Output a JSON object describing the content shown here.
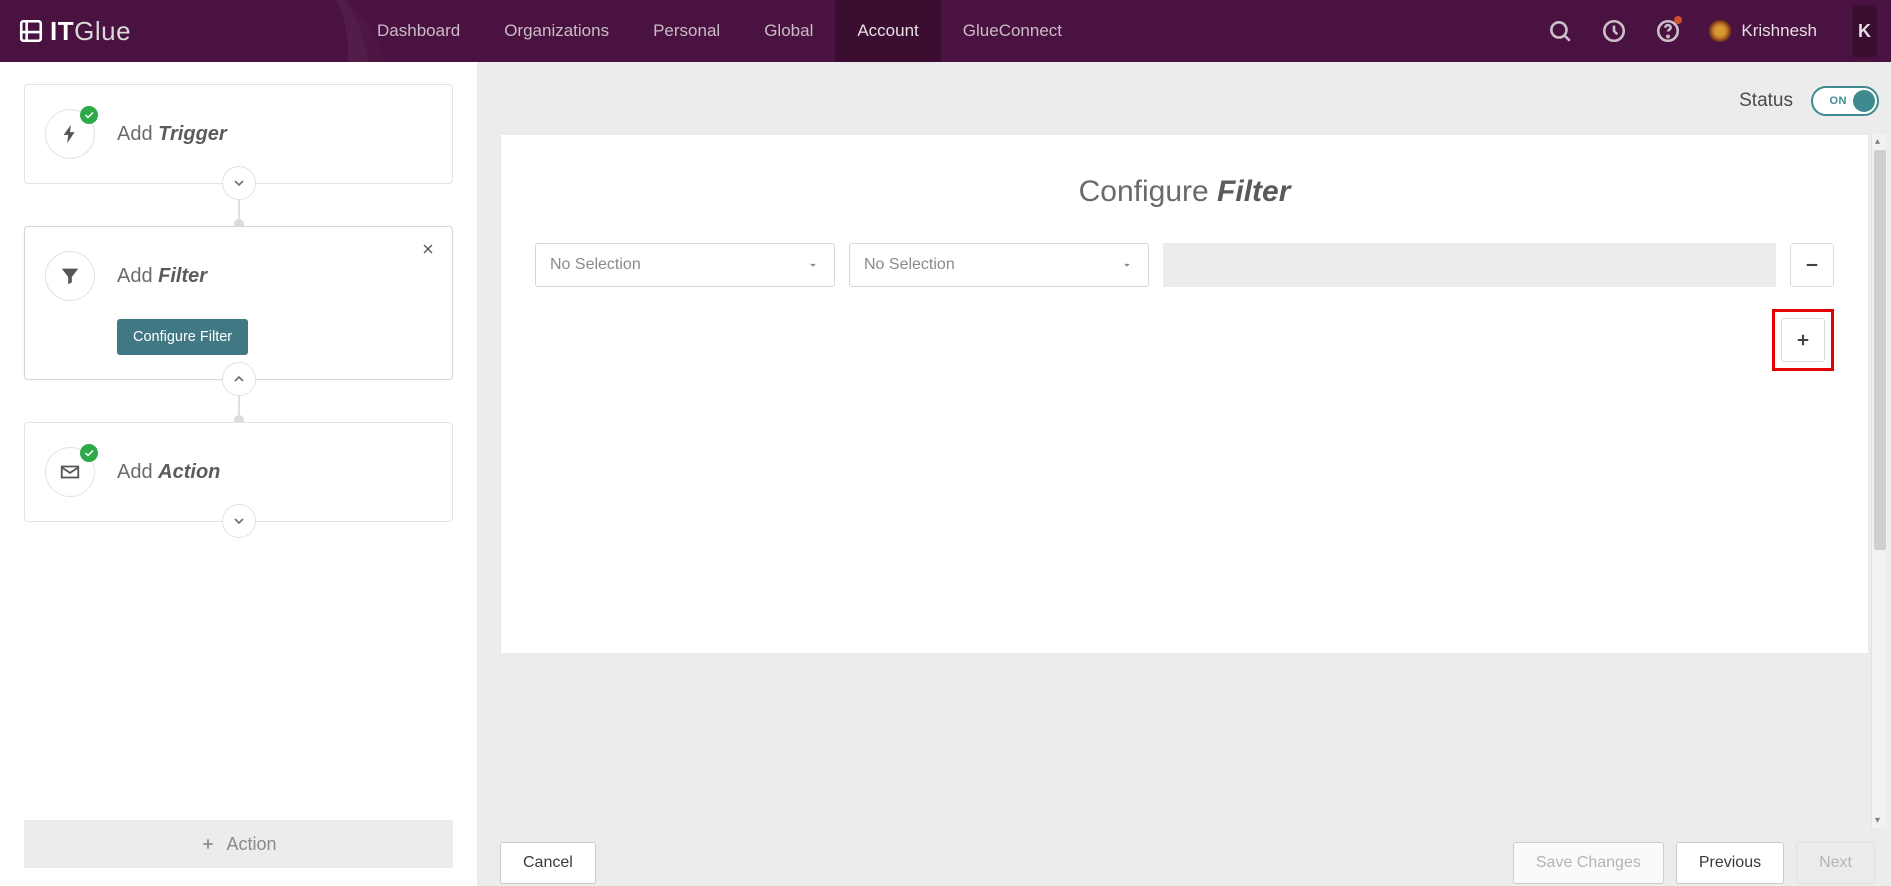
{
  "app": {
    "logo_it": "IT",
    "logo_glue": "Glue"
  },
  "nav": {
    "links": [
      "Dashboard",
      "Organizations",
      "Personal",
      "Global",
      "Account",
      "GlueConnect"
    ],
    "active_index": 4,
    "user_name": "Krishnesh"
  },
  "status": {
    "label": "Status",
    "toggle_text": "ON",
    "toggle_on": true
  },
  "workflow": {
    "steps": [
      {
        "verb": "Add",
        "noun": "Trigger",
        "icon": "bolt",
        "checked": true,
        "chevron": "down"
      },
      {
        "verb": "Add",
        "noun": "Filter",
        "icon": "funnel",
        "checked": false,
        "removable": true,
        "chevron": "up",
        "configure_label": "Configure Filter",
        "selected": true
      },
      {
        "verb": "Add",
        "noun": "Action",
        "icon": "envelope",
        "checked": true,
        "chevron": "down"
      }
    ],
    "add_action_label": "Action"
  },
  "panel": {
    "title_prefix": "Configure",
    "title_emph": "Filter",
    "select1": "No Selection",
    "select2": "No Selection"
  },
  "footer": {
    "cancel": "Cancel",
    "save": "Save Changes",
    "previous": "Previous",
    "next": "Next"
  }
}
